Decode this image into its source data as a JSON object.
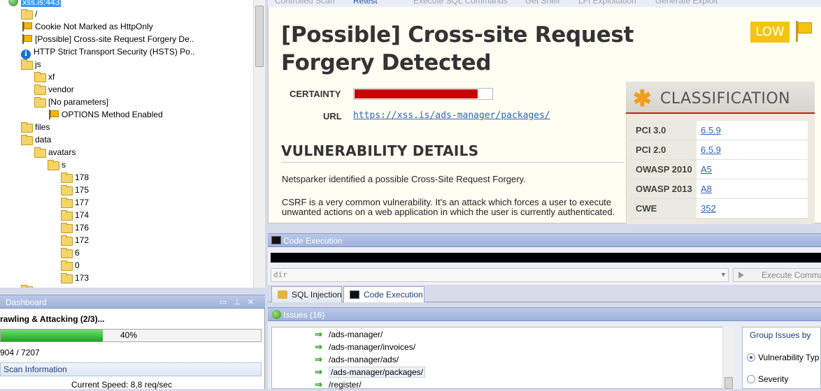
{
  "tree": {
    "root": "xss.is:443",
    "nodes": [
      {
        "label": "/",
        "icon": "folder-icon"
      },
      {
        "label": "Cookie Not Marked as HttpOnly",
        "icon": "flag-icon"
      },
      {
        "label": "[Possible] Cross-site Request Forgery De..",
        "icon": "flag-icon"
      },
      {
        "label": "HTTP Strict Transport Security (HSTS) Po..",
        "icon": "info-icon"
      },
      {
        "label": "js",
        "icon": "folder-icon"
      },
      {
        "label": "xf",
        "icon": "folder-icon"
      },
      {
        "label": "vendor",
        "icon": "folder-icon"
      },
      {
        "label": "[No parameters]",
        "icon": "folder-icon"
      },
      {
        "label": "OPTIONS Method Enabled",
        "icon": "flag-icon"
      },
      {
        "label": "files",
        "icon": "folder-icon"
      },
      {
        "label": "data",
        "icon": "folder-icon"
      },
      {
        "label": "avatars",
        "icon": "folder-icon"
      },
      {
        "label": "s",
        "icon": "folder-icon"
      },
      {
        "label": "178",
        "icon": "folder-icon"
      },
      {
        "label": "175",
        "icon": "folder-icon"
      },
      {
        "label": "177",
        "icon": "folder-icon"
      },
      {
        "label": "174",
        "icon": "folder-icon"
      },
      {
        "label": "176",
        "icon": "folder-icon"
      },
      {
        "label": "172",
        "icon": "folder-icon"
      },
      {
        "label": "6",
        "icon": "folder-icon"
      },
      {
        "label": "0",
        "icon": "folder-icon"
      },
      {
        "label": "173",
        "icon": "folder-icon"
      }
    ]
  },
  "dashboard": {
    "title": "Dashboard",
    "phase": "rawling & Attacking (2/3)...",
    "progress_percent": 40,
    "progress_label": "40%",
    "requests": "904 / 7207",
    "scan_info_title": "Scan Information",
    "speed_label": "Current Speed:",
    "speed_value": "8,8 req/sec"
  },
  "toolbar": {
    "items": [
      "Controlled Scan",
      "Retest",
      "Execute SQL Commands",
      "Get Shell",
      "LFI Exploitation",
      "Generate Exploit"
    ]
  },
  "report": {
    "title": "[Possible] Cross-site Request Forgery Detected",
    "severity": "LOW",
    "certainty_label": "CERTAINTY",
    "certainty_percent": 90,
    "url_label": "URL",
    "url": "https://xss.is/ads-manager/packages/",
    "details_heading": "VULNERABILITY DETAILS",
    "paragraph1": "Netsparker identified a possible Cross-Site Request Forgery.",
    "paragraph2": "CSRF is a very common vulnerability. It's an attack which forces a user to execute unwanted actions on a web application in which the user is currently authenticated."
  },
  "classification": {
    "title": "CLASSIFICATION",
    "rows": [
      {
        "key": "PCI 3.0",
        "value": "6.5.9"
      },
      {
        "key": "PCI 2.0",
        "value": "6.5.9"
      },
      {
        "key": "OWASP 2010",
        "value": "A5"
      },
      {
        "key": "OWASP 2013",
        "value": "A8"
      },
      {
        "key": "CWE",
        "value": "352"
      }
    ]
  },
  "code_execution": {
    "title": "Code Execution",
    "command": "dir",
    "execute_label": "Execute Comma"
  },
  "tabs": {
    "sql": "SQL Injection",
    "code": "Code Execution"
  },
  "issues": {
    "title": "Issues (16)",
    "rows": [
      "/ads-manager/",
      "/ads-manager/invoices/",
      "/ads-manager/ads/",
      "/ads-manager/packages/",
      "/register/"
    ],
    "group_title": "Group Issues by",
    "group_options": [
      "Vulnerability Typ",
      "Severity"
    ]
  },
  "colors": {
    "severity_low": "#f4c510",
    "certainty_fill": "#c90000",
    "progress_fill": "#1fa31f",
    "link": "#2e64b9",
    "panel_header": "#9fb3dc"
  }
}
